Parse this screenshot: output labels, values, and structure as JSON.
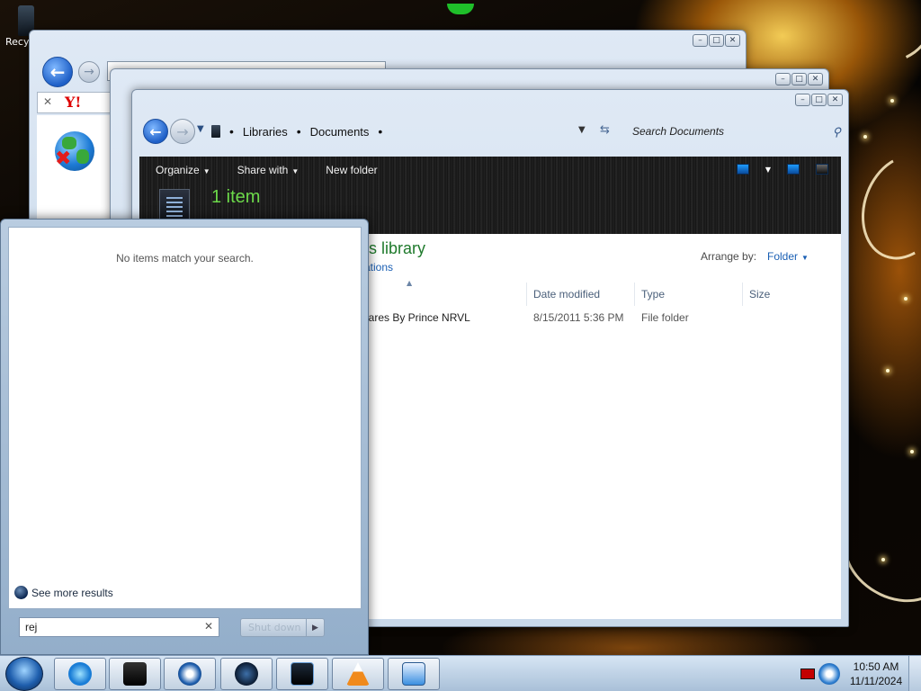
{
  "desktop": {
    "recycle_label": "Recy"
  },
  "explorer": {
    "breadcrumbs": [
      "Libraries",
      "Documents"
    ],
    "search_placeholder": "Search Documents",
    "toolbar": {
      "organize": "Organize",
      "share_with": "Share with",
      "new_folder": "New folder"
    },
    "item_count": "1 item",
    "library_title": "ts library",
    "library_subtitle": "ations",
    "arrange_by_label": "Arrange by:",
    "arrange_by_value": "Folder",
    "columns": {
      "date_modified": "Date modified",
      "type": "Type",
      "size": "Size"
    },
    "rows": [
      {
        "name": "wares By Prince NRVL",
        "date_modified": "8/15/2011 5:36 PM",
        "type": "File folder"
      }
    ]
  },
  "start_menu": {
    "no_items": "No items match your search.",
    "see_more": "See more results",
    "search_value": "rej",
    "shutdown_label": "Shut down"
  },
  "taskbar": {
    "time": "10:50 AM",
    "date": "11/11/2024"
  }
}
